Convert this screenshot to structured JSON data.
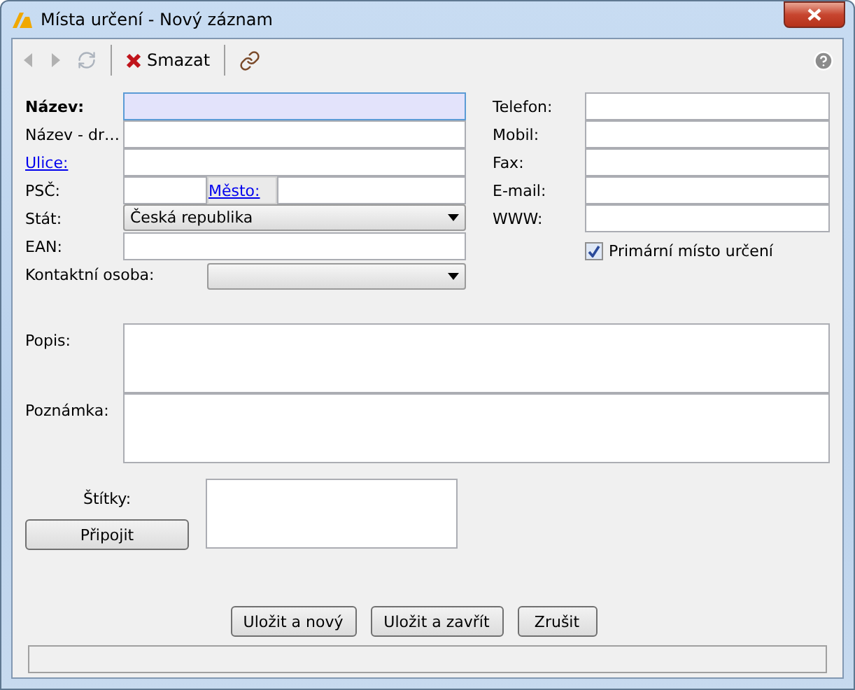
{
  "window": {
    "title": "Místa určení - Nový záznam"
  },
  "toolbar": [
    {
      "kind": "back",
      "disabled": true
    },
    {
      "kind": "forward",
      "disabled": true
    },
    {
      "kind": "refresh",
      "disabled": true
    },
    {
      "kind": "delete",
      "label": "Smazat",
      "disabled": false
    },
    {
      "kind": "link",
      "disabled": false
    }
  ],
  "left_fields": [
    {
      "kind": "text",
      "label": "Název:",
      "bold": true,
      "link": false,
      "focused": true
    },
    {
      "kind": "text",
      "label": "Název - dr…",
      "bold": false,
      "link": false,
      "focused": false
    },
    {
      "kind": "text",
      "label": "Ulice:",
      "bold": false,
      "link": true,
      "focused": false
    },
    {
      "kind": "postal",
      "label": "PSČ:",
      "bold": false,
      "link": false,
      "city_label": "Město:"
    },
    {
      "kind": "select",
      "label": "Stát:",
      "bold": false,
      "link": false,
      "value": "Česká republika"
    },
    {
      "kind": "text",
      "label": "EAN:",
      "bold": false,
      "link": false,
      "focused": false
    },
    {
      "kind": "combo",
      "label": "Kontaktní osoba:",
      "bold": false,
      "link": false
    }
  ],
  "right_fields": [
    {
      "label": "Telefon:"
    },
    {
      "label": "Mobil:"
    },
    {
      "label": "Fax:"
    },
    {
      "label": "E-mail:"
    },
    {
      "label": "WWW:"
    }
  ],
  "primary_checkbox": {
    "label": "Primární místo určení",
    "checked": true
  },
  "notes": [
    {
      "label": "Popis:"
    },
    {
      "label": "Poznámka:"
    }
  ],
  "tags": {
    "label": "Štítky:",
    "button": "Připojit"
  },
  "buttons": [
    "Uložit a nový",
    "Uložit a zavřít",
    "Zrušit"
  ]
}
